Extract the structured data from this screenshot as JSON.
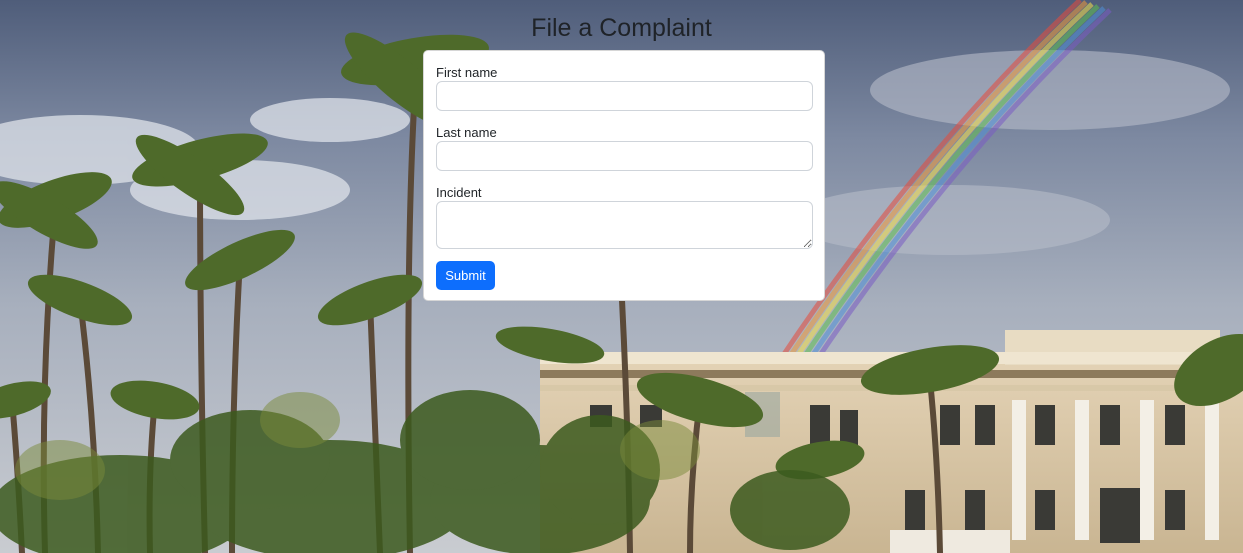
{
  "page": {
    "title": "File a Complaint"
  },
  "form": {
    "first_name": {
      "label": "First name",
      "value": "",
      "placeholder": ""
    },
    "last_name": {
      "label": "Last name",
      "value": "",
      "placeholder": ""
    },
    "incident": {
      "label": "Incident",
      "value": "",
      "placeholder": ""
    },
    "submit_label": "Submit"
  },
  "colors": {
    "accent": "#0d6efd",
    "card_background": "#ffffff",
    "title_text": "#1f2328"
  }
}
